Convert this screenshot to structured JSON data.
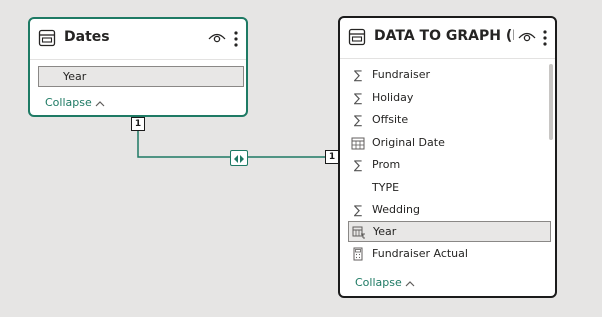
{
  "colors": {
    "canvas": "#e6e5e4",
    "accent": "#1e7a64",
    "card_border_selected": "#1b1b1b",
    "text": "#252423"
  },
  "dates_table": {
    "title": "Dates",
    "fields": [
      {
        "label": "Year",
        "icon": "none",
        "selected": true
      }
    ],
    "collapse_label": "Collapse"
  },
  "data_table": {
    "title": "DATA TO GRAPH (DA...",
    "fields": [
      {
        "label": "Fundraiser",
        "icon": "sigma-icon"
      },
      {
        "label": "Holiday",
        "icon": "sigma-icon"
      },
      {
        "label": "Offsite",
        "icon": "sigma-icon"
      },
      {
        "label": "Original Date",
        "icon": "calendar-icon"
      },
      {
        "label": "Prom",
        "icon": "sigma-icon"
      },
      {
        "label": "TYPE",
        "icon": "none"
      },
      {
        "label": "Wedding",
        "icon": "sigma-icon"
      },
      {
        "label": "Year",
        "icon": "date-hierarchy-icon",
        "selected": true
      },
      {
        "label": "Fundraiser Actual",
        "icon": "calculator-icon"
      }
    ],
    "collapse_label": "Collapse"
  },
  "relationship": {
    "from_cardinality": "1",
    "to_cardinality": "1",
    "cross_filter": "both"
  }
}
